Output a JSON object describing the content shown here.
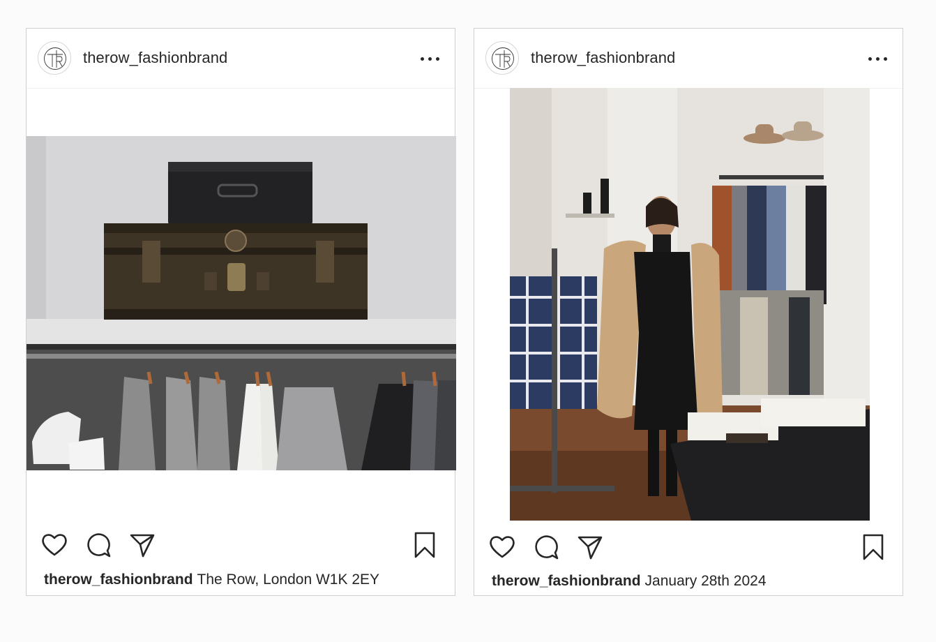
{
  "posts": [
    {
      "username": "therow_fashionbrand",
      "avatar_icon": "the-row-monogram-logo",
      "menu_icon": "more-horizontal-icon",
      "caption_user": "therow_fashionbrand",
      "caption_text": "The Row, London W1K 2EY",
      "image": "photo of two vintage trunks stacked on a shelf above a rail of hanging garments and white sneakers",
      "actions": [
        "heart-icon",
        "comment-icon",
        "share-icon",
        "bookmark-icon"
      ]
    },
    {
      "username": "therow_fashionbrand",
      "avatar_icon": "the-row-monogram-logo",
      "menu_icon": "more-horizontal-icon",
      "caption_user": "therow_fashionbrand",
      "caption_text": "January 28th 2024",
      "image": "photo of a woman in a black dress and camel coat standing in a clothing store",
      "actions": [
        "heart-icon",
        "comment-icon",
        "share-icon",
        "bookmark-icon"
      ]
    }
  ],
  "colors": {
    "text": "#262626",
    "border": "#cfcfcf",
    "background": "#fbfbfb",
    "card": "#ffffff"
  }
}
